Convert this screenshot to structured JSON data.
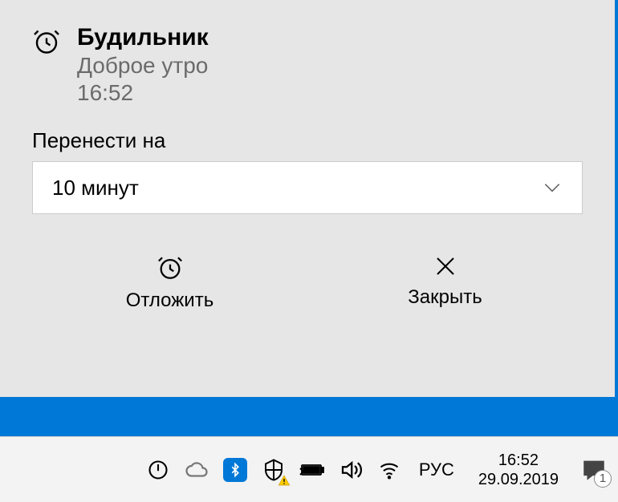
{
  "notification": {
    "title": "Будильник",
    "subtitle": "Доброе утро",
    "time": "16:52",
    "snooze_label": "Перенести на",
    "snooze_value": "10 минут",
    "actions": {
      "snooze": "Отложить",
      "dismiss": "Закрыть"
    }
  },
  "taskbar": {
    "language": "РУС",
    "clock_time": "16:52",
    "clock_date": "29.09.2019",
    "notification_count": "1"
  }
}
